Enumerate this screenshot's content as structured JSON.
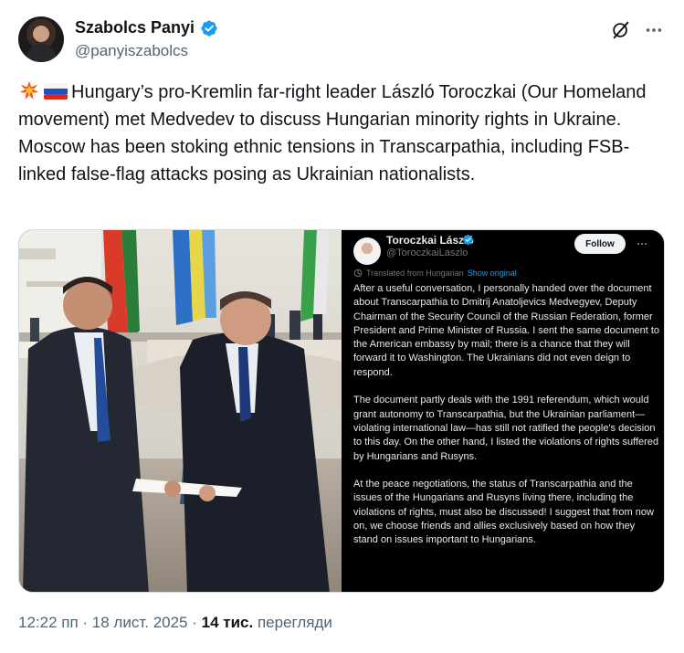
{
  "author": {
    "name": "Szabolcs Panyi",
    "handle": "@panyiszabolcs"
  },
  "tweet": {
    "text": "Hungary’s pro-Kremlin far-right leader László Toroczkai (Our Homeland movement) met Medvedev to discuss Hungarian minority rights in Ukraine. Moscow has been stoking ethnic tensions in Transcarpathia, including FSB-linked false-flag attacks posing as Ukrainian nationalists."
  },
  "embedded_post": {
    "name": "Toroczkai László",
    "handle": "@ToroczkaiLaszlo",
    "follow_label": "Follow",
    "translated_label": "Translated from Hungarian",
    "show_original_label": "Show original",
    "paragraphs": [
      "After a useful conversation, I personally handed over the document about Transcarpathia to Dmitrij Anatoljevics Medvegyev, Deputy Chairman of the Security Council of the Russian Federation, former President and Prime Minister of Russia. I sent the same document to the American embassy by mail; there is a chance that they will forward it to Washington. The Ukrainians did not even deign to respond.",
      "The document partly deals with the 1991 referendum, which would grant autonomy to Transcarpathia, but the Ukrainian parliament—violating international law—has still not ratified the people's decision to this day. On the other hand, I listed the violations of rights suffered by Hungarians and Rusyns.",
      "At the peace negotiations, the status of Transcarpathia and the issues of the Hungarians and Rusyns living there, including the violations of rights, must also be discussed! I suggest that from now on, we choose friends and allies exclusively based on how they stand on issues important to Hungarians."
    ]
  },
  "meta": {
    "time": "12:22 пп",
    "separator": " · ",
    "date": "18 лист. 2025",
    "separator2": " · ",
    "views_count": "14 тис.",
    "views_label": " перегляди"
  },
  "colors": {
    "text": "#0f1419",
    "secondary": "#536471",
    "verified": "#1d9bf0",
    "link": "#1d9bf0"
  },
  "icons": [
    "verified-badge-icon",
    "grok-icon",
    "more-icon",
    "collision-emoji-icon",
    "russia-flag-icon"
  ]
}
